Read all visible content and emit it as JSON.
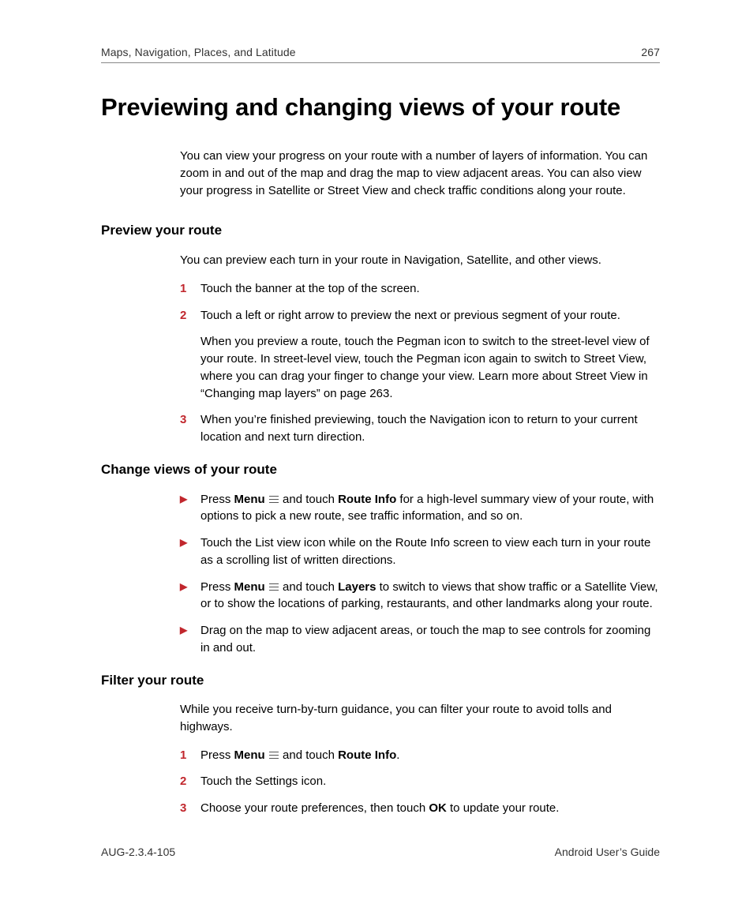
{
  "header": {
    "chapter": "Maps, Navigation, Places, and Latitude",
    "page": "267"
  },
  "title": "Previewing and changing views of your route",
  "intro": "You can view your progress on your route with a number of layers of information. You can zoom in and out of the map and drag the map to view adjacent areas. You can also view your progress in Satellite or Street View and check traffic conditions along your route.",
  "s1": {
    "heading": "Preview your route",
    "intro": "You can preview each turn in your route in Navigation, Satellite, and other views.",
    "n1": "1",
    "t1": "Touch the banner at the top of the screen.",
    "n2": "2",
    "t2": "Touch a left or right arrow to preview the next or previous segment of your route.",
    "t2b": "When you preview a route, touch the Pegman icon to switch to the street-level view of your route. In street-level view, touch the Pegman icon again to switch to Street View, where you can drag your finger to change your view. Learn more about Street View in “Changing map layers” on page 263.",
    "n3": "3",
    "t3": "When you’re finished previewing, touch the Navigation icon to return to your current location and next turn direction."
  },
  "s2": {
    "heading": "Change views of your route",
    "b1a": "Press ",
    "b1m": "Menu",
    "b1b": " and touch ",
    "b1r": "Route Info",
    "b1c": " for a high-level summary view of your route, with options to pick a new route, see traffic information, and so on.",
    "b2": "Touch the List view icon while on the Route Info screen to view each turn in your route as a scrolling list of written directions.",
    "b3a": "Press ",
    "b3m": "Menu",
    "b3b": " and touch ",
    "b3l": "Layers",
    "b3c": " to switch to views that show traffic or a Satellite View, or to show the locations of parking, restaurants, and other landmarks along your route.",
    "b4": "Drag on the map to view adjacent areas, or touch the map to see controls for zooming in and out."
  },
  "s3": {
    "heading": "Filter your route",
    "intro": "While you receive turn-by-turn guidance, you can filter your route to avoid tolls and highways.",
    "n1": "1",
    "t1a": "Press ",
    "t1m": "Menu",
    "t1b": " and touch ",
    "t1r": "Route Info",
    "t1c": ".",
    "n2": "2",
    "t2": "Touch the Settings icon.",
    "n3": "3",
    "t3a": "Choose your route preferences, then touch ",
    "t3o": "OK",
    "t3b": " to update your route."
  },
  "footer": {
    "left": "AUG-2.3.4-105",
    "right": "Android User’s Guide"
  }
}
